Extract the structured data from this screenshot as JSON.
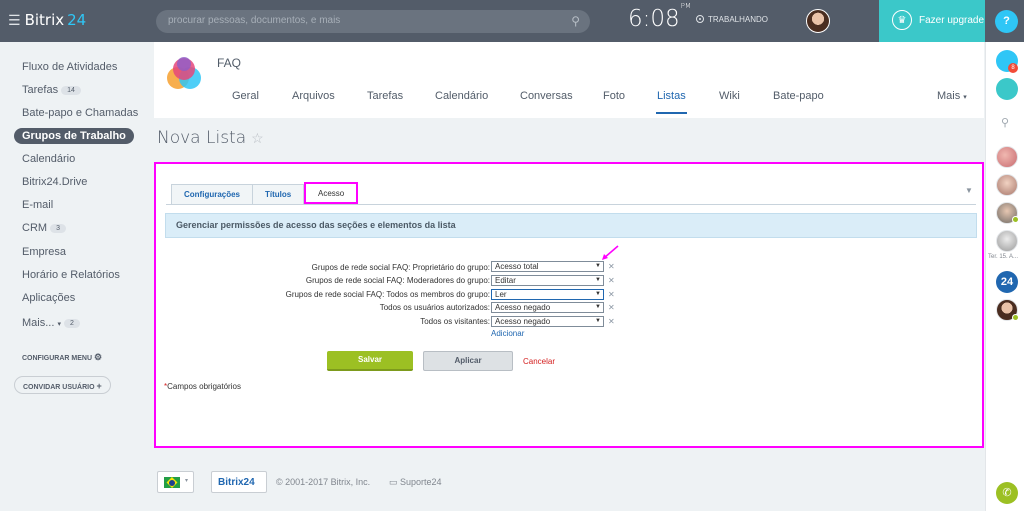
{
  "topbar": {
    "brand_name": "Bitrix",
    "brand_number": "24",
    "search_placeholder": "procurar pessoas, documentos, e mais",
    "clock_time": "6:08",
    "clock_ampm": "PM",
    "work_status": "TRABALHANDO",
    "upgrade_label": "Fazer upgrade",
    "help_label": "?"
  },
  "leftmenu": {
    "items": [
      {
        "label": "Fluxo de Atividades"
      },
      {
        "label": "Tarefas",
        "badge": "14"
      },
      {
        "label": "Bate-papo e Chamadas"
      },
      {
        "label": "Grupos de Trabalho"
      },
      {
        "label": "Calendário"
      },
      {
        "label": "Bitrix24.Drive"
      },
      {
        "label": "E-mail"
      },
      {
        "label": "CRM",
        "badge": "3"
      },
      {
        "label": "Empresa"
      },
      {
        "label": "Horário e Relatórios"
      },
      {
        "label": "Aplicações"
      },
      {
        "label": "Mais...",
        "badge": "2"
      }
    ],
    "configure_label": "CONFIGURAR MENU",
    "invite_label": "CONVIDAR USUÁRIO"
  },
  "group": {
    "name": "FAQ",
    "tabs": [
      {
        "label": "Geral"
      },
      {
        "label": "Arquivos"
      },
      {
        "label": "Tarefas"
      },
      {
        "label": "Calendário"
      },
      {
        "label": "Conversas"
      },
      {
        "label": "Foto"
      },
      {
        "label": "Listas"
      },
      {
        "label": "Wiki"
      },
      {
        "label": "Bate-papo"
      },
      {
        "label": "Mais"
      }
    ],
    "active_tab": "Listas"
  },
  "page": {
    "title": "Nova Lista"
  },
  "form": {
    "tabs": [
      "Configurações",
      "Títulos",
      "Acesso"
    ],
    "section_title": "Gerenciar permissões de acesso das seções e elementos da lista",
    "permissions": [
      {
        "label": "Grupos de rede social FAQ: Proprietário do grupo:",
        "value": "Acesso total"
      },
      {
        "label": "Grupos de rede social FAQ: Moderadores do grupo:",
        "value": "Editar"
      },
      {
        "label": "Grupos de rede social FAQ: Todos os membros do grupo:",
        "value": "Ler"
      },
      {
        "label": "Todos os usuários autorizados:",
        "value": "Acesso negado"
      },
      {
        "label": "Todos os visitantes:",
        "value": "Acesso negado"
      }
    ],
    "add_label": "Adicionar",
    "save_label": "Salvar",
    "apply_label": "Aplicar",
    "cancel_label": "Cancelar",
    "required_note": "Campos obrigatórios"
  },
  "footer": {
    "logo_text": "Bitrix24",
    "copyright": "© 2001-2017 Bitrix, Inc.",
    "support": "Suporte24"
  },
  "rightbar": {
    "notification_count": "8",
    "date_label": "Ter. 15. A...",
    "b24_label": "24"
  }
}
